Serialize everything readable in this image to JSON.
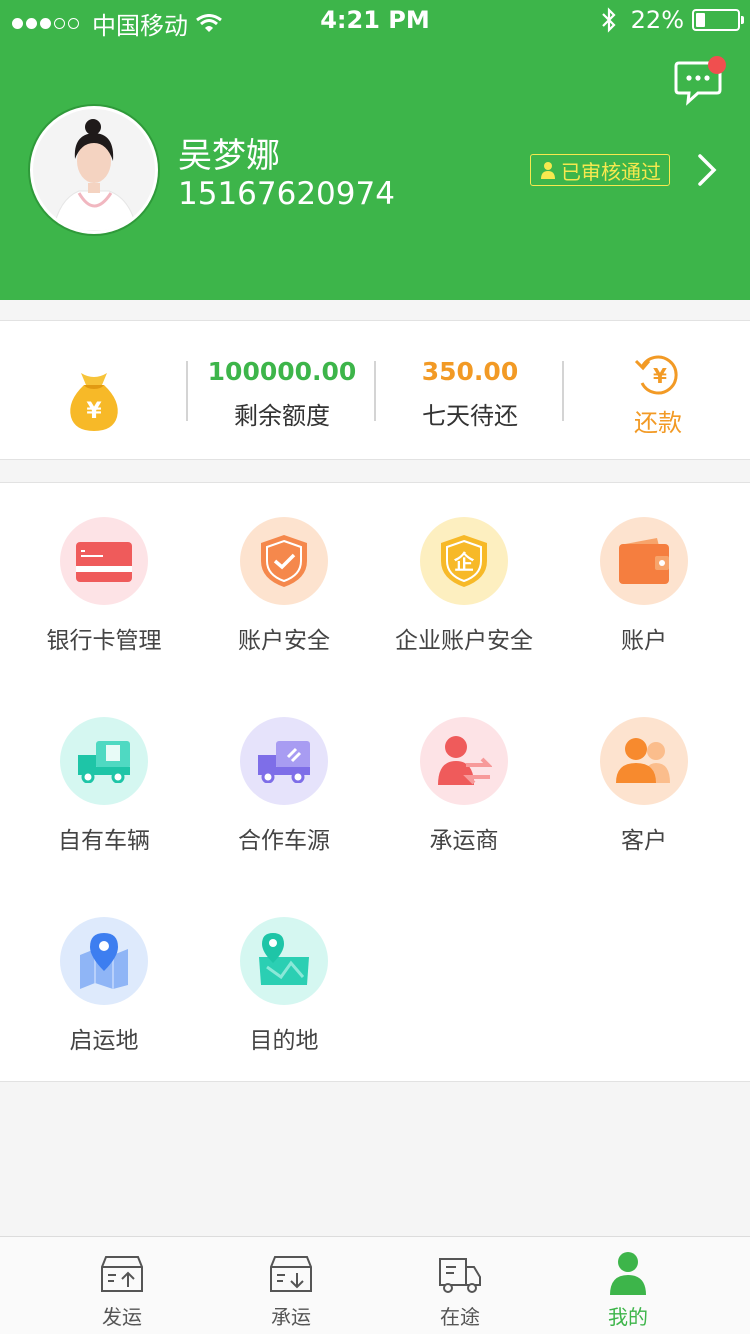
{
  "status_bar": {
    "carrier": "中国移动",
    "time": "4:21 PM",
    "battery": "22%",
    "battery_level": 0.22,
    "signal_bars": 3
  },
  "profile": {
    "name": "吴梦娜",
    "phone": "15167620974",
    "verify_status": "已审核通过"
  },
  "stats": {
    "remaining_amount": "100000.00",
    "remaining_label": "剩余额度",
    "due_amount": "350.00",
    "due_label": "七天待还",
    "repay_label": "还款"
  },
  "menu": [
    {
      "label": "银行卡管理",
      "icon": "bank-card-icon"
    },
    {
      "label": "账户安全",
      "icon": "shield-check-icon"
    },
    {
      "label": "企业账户安全",
      "icon": "enterprise-shield-icon"
    },
    {
      "label": "账户",
      "icon": "wallet-icon"
    },
    {
      "label": "自有车辆",
      "icon": "own-truck-icon"
    },
    {
      "label": "合作车源",
      "icon": "partner-truck-icon"
    },
    {
      "label": "承运商",
      "icon": "carrier-user-icon"
    },
    {
      "label": "客户",
      "icon": "customers-icon"
    },
    {
      "label": "启运地",
      "icon": "origin-map-icon"
    },
    {
      "label": "目的地",
      "icon": "destination-map-icon"
    }
  ],
  "tabs": [
    {
      "label": "发运",
      "icon": "ship-out-icon"
    },
    {
      "label": "承运",
      "icon": "carry-in-icon"
    },
    {
      "label": "在途",
      "icon": "in-transit-icon"
    },
    {
      "label": "我的",
      "icon": "profile-icon",
      "active": true
    }
  ],
  "colors": {
    "brand_green": "#3db54a",
    "amount_green": "#3db54a",
    "amount_orange": "#f29a25",
    "verify_yellow": "#f6e94f",
    "badge_red": "#f04f4f"
  }
}
